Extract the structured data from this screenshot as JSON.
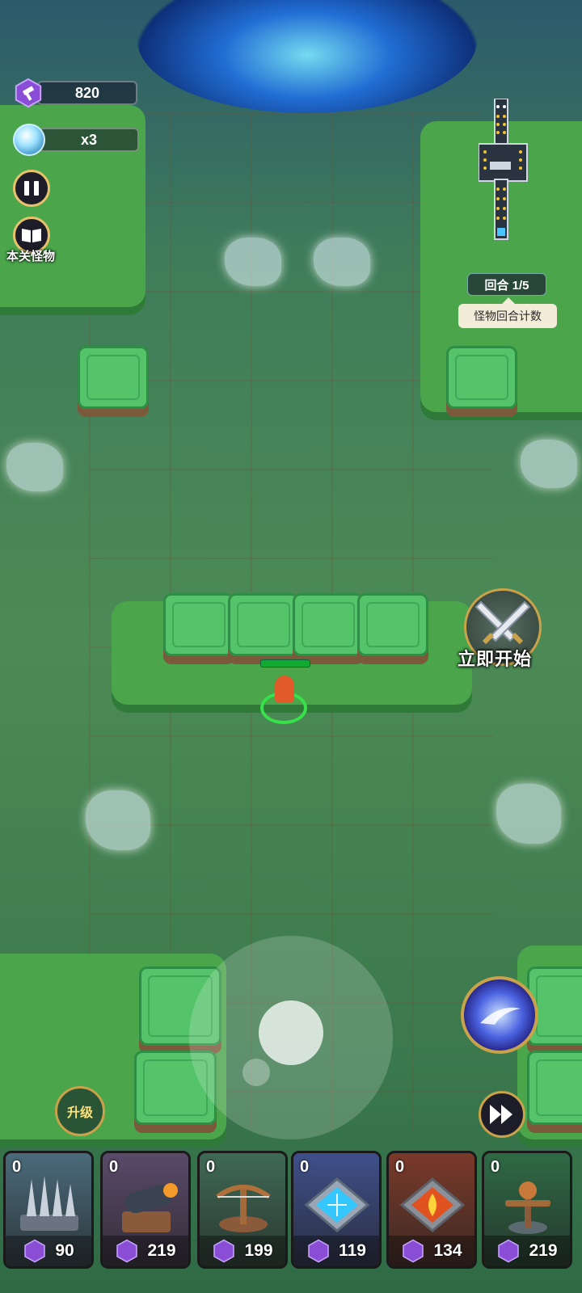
{
  "hud": {
    "gems": "820",
    "orbs": "x3",
    "level_monsters_label": "本关怪物"
  },
  "round": {
    "label": "回合 1/5",
    "tooltip": "怪物回合计数"
  },
  "start_button_label": "立即开始",
  "upgrade_label": "升级",
  "cards": [
    {
      "count": "0",
      "price": "90",
      "name": "spike-trap",
      "bg": "#4a6a7a"
    },
    {
      "count": "0",
      "price": "219",
      "name": "cannon-tower",
      "bg": "#5a4a6a"
    },
    {
      "count": "0",
      "price": "199",
      "name": "crossbow-tower",
      "bg": "#3f6a55"
    },
    {
      "count": "0",
      "price": "119",
      "name": "frost-trap",
      "bg": "#3f4f8a"
    },
    {
      "count": "0",
      "price": "134",
      "name": "fire-trap",
      "bg": "#7a3a2a"
    },
    {
      "count": "0",
      "price": "219",
      "name": "scarecrow-decoy",
      "bg": "#2f6a45"
    }
  ],
  "colors": {
    "gem": "#8a4dd6",
    "accent_gold": "#c9a24a",
    "grass": "#55c36a",
    "floor": "#d2a77d"
  }
}
